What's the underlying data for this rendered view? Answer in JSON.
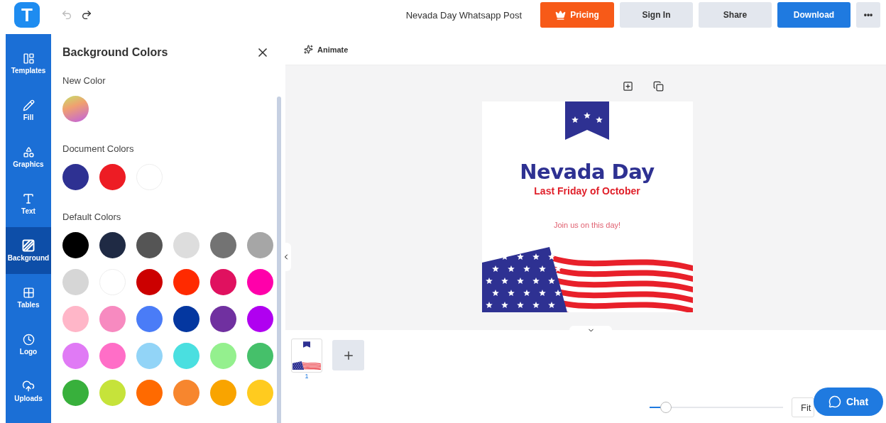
{
  "app": {
    "logo": "T"
  },
  "header": {
    "document_title": "Nevada Day Whatsapp Post",
    "buttons": [
      {
        "label": "Pricing",
        "kind": "pricing"
      },
      {
        "label": "Sign In",
        "kind": "secondary"
      },
      {
        "label": "Share",
        "kind": "secondary"
      },
      {
        "label": "Download",
        "kind": "primary"
      },
      {
        "label": "•••",
        "kind": "more"
      }
    ]
  },
  "sidebar": {
    "items": [
      {
        "label": "Templates",
        "kind": "templates",
        "selected": false
      },
      {
        "label": "Fill",
        "kind": "fill",
        "selected": false
      },
      {
        "label": "Graphics",
        "kind": "graphics",
        "selected": false
      },
      {
        "label": "Text",
        "kind": "text",
        "selected": false
      },
      {
        "label": "Background",
        "kind": "background",
        "selected": true
      },
      {
        "label": "Tables",
        "kind": "tables",
        "selected": false
      },
      {
        "label": "Logo",
        "kind": "logo",
        "selected": false
      },
      {
        "label": "Uploads",
        "kind": "uploads",
        "selected": false
      }
    ]
  },
  "panel": {
    "title": "Background Colors",
    "new_color": {
      "label": "New Color"
    },
    "document_colors": {
      "label": "Document Colors",
      "swatches": [
        {
          "color": "#2e3192"
        },
        {
          "color": "#ed1c24"
        },
        {
          "color": "#ffffff"
        }
      ]
    },
    "default_colors": {
      "label": "Default Colors",
      "swatches": [
        {
          "color": "#000000"
        },
        {
          "color": "#1f2a44"
        },
        {
          "color": "#555555"
        },
        {
          "color": "#dddddd"
        },
        {
          "color": "#737373"
        },
        {
          "color": "#a6a6a6"
        },
        {
          "color": "#d6d6d6"
        },
        {
          "color": "#ffffff"
        },
        {
          "color": "#cc0000"
        },
        {
          "color": "#ff2a00"
        },
        {
          "color": "#e0115f"
        },
        {
          "color": "#ff00aa"
        },
        {
          "color": "#ffb6c8"
        },
        {
          "color": "#f78ac0"
        },
        {
          "color": "#4a7cf7"
        },
        {
          "color": "#0437a0"
        },
        {
          "color": "#7030a0"
        },
        {
          "color": "#b000f0"
        },
        {
          "color": "#e07af5"
        },
        {
          "color": "#ff6ec7"
        },
        {
          "color": "#92d4f7"
        },
        {
          "color": "#4adfe0"
        },
        {
          "color": "#94f08e"
        },
        {
          "color": "#45c06a"
        },
        {
          "color": "#38b03c"
        },
        {
          "color": "#c6e33a"
        },
        {
          "color": "#ff6a00"
        },
        {
          "color": "#f7862e"
        },
        {
          "color": "#f9a400"
        },
        {
          "color": "#ffcb1f"
        }
      ]
    }
  },
  "toolbar": {
    "animate": "Animate"
  },
  "design": {
    "title": "Nevada Day",
    "subtitle": "Last Friday of October",
    "tagline": "Join us on this day!"
  },
  "pages": [
    {
      "number": "1"
    }
  ],
  "zoom": {
    "level": 0.12,
    "mode": "Fit"
  },
  "chat": {
    "label": "Chat"
  }
}
